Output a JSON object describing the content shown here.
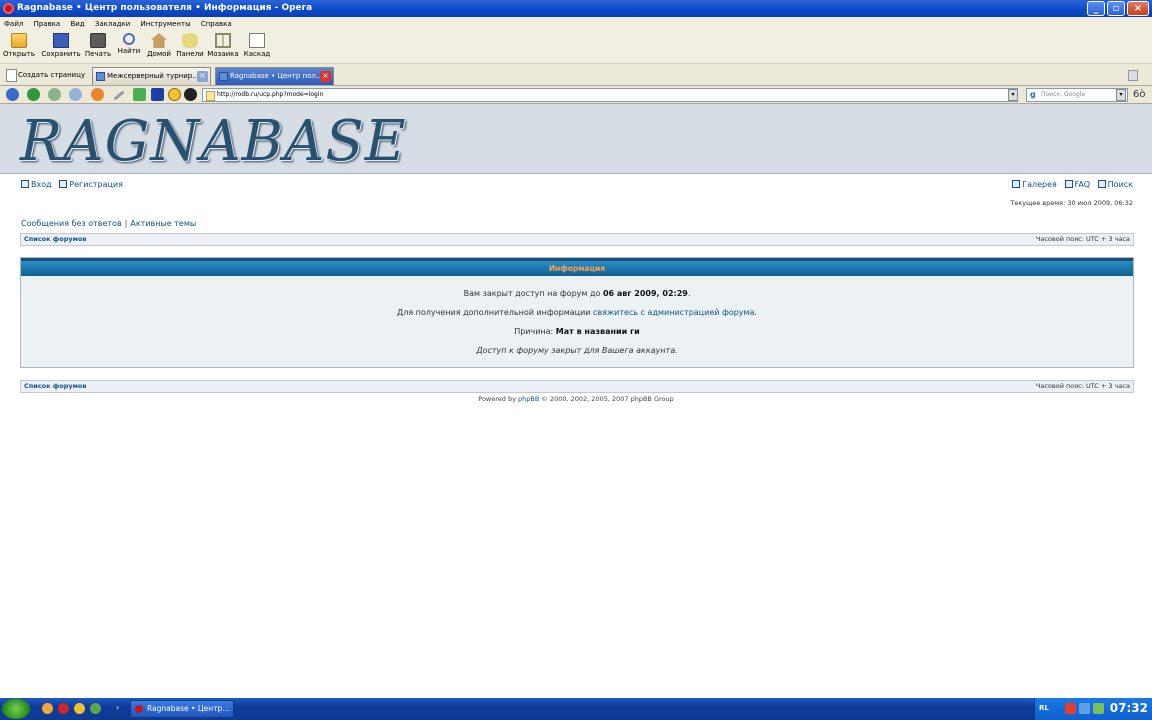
{
  "window": {
    "title": "Ragnabase • Центр пользователя • Информация - Opera"
  },
  "menu": [
    "Файл",
    "Правка",
    "Вид",
    "Закладки",
    "Инструменты",
    "Справка"
  ],
  "toolbar": {
    "open": "Открыть",
    "save": "Сохранить",
    "print": "Печать",
    "find": "Найти",
    "home": "Домой",
    "panels": "Панели",
    "mosaic": "Мозаика",
    "cascade": "Каскад"
  },
  "tabs": {
    "new_tab": "Создать страницу",
    "tab1": "Межсерверный турнир....",
    "tab2": "Ragnabase • Центр пол..."
  },
  "address": {
    "url": "http://rodb.ru/ucp.php?mode=login",
    "search_placeholder": "Поиск: Google"
  },
  "forum": {
    "logo": "RAGNABASE",
    "login": "Вход",
    "register": "Регистрация",
    "gallery": "Галерея",
    "faq": "FAQ",
    "search": "Поиск",
    "current_time": "Текущее время: 30 июл 2009, 06:32",
    "unanswered": "Сообщения без ответов",
    "active": "Активные темы",
    "forum_index": "Список форумов",
    "timezone": "Часовой пояс: UTC + 3 часа",
    "info_title": "Информация",
    "ban_prefix": "Вам закрыт доступ на форум до",
    "ban_date": "06 авг 2009, 02:29",
    "contact_prefix": "Для получения дополнительной информации",
    "contact_link": "свяжитесь с администрацией форума",
    "reason_label": "Причина:",
    "reason_value": "Мат в названии ги",
    "closed_note": "Доступ к форуму закрыт для Вашега аккаунта.",
    "powered_prefix": "Powered by",
    "powered_link": "phpBB",
    "powered_suffix": "© 2000, 2002, 2005, 2007 phpBB Group"
  },
  "taskbar": {
    "button": "Ragnabase • Центр...",
    "lang": "RL",
    "clock": "07:32"
  }
}
